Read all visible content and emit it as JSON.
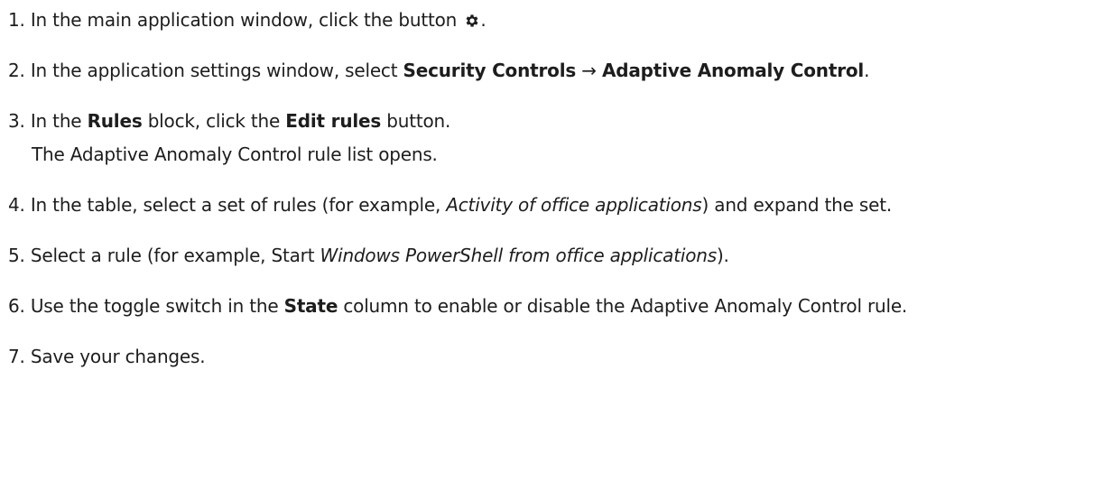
{
  "steps": [
    {
      "num": "1.",
      "a": " In the main application window, click the button ",
      "icon": "gear-icon",
      "b": "."
    },
    {
      "num": "2.",
      "a": " In the application settings window, select ",
      "bold1": "Security Controls",
      "arrow": " → ",
      "bold2": "Adaptive Anomaly Control",
      "b": "."
    },
    {
      "num": "3.",
      "a": " In the ",
      "bold1": "Rules",
      "mid": " block, click the ",
      "bold2": "Edit rules",
      "b": " button.",
      "sub": "The Adaptive Anomaly Control rule list opens."
    },
    {
      "num": "4.",
      "a": " In the table, select a set of rules (for example, ",
      "italic": "Activity of office applications",
      "b": ") and expand the set."
    },
    {
      "num": "5.",
      "a": " Select a rule (for example, Start ",
      "italic": "Windows PowerShell from office applications",
      "b": ")."
    },
    {
      "num": "6.",
      "a": " Use the toggle switch in the ",
      "bold1": "State",
      "b": " column to enable or disable the Adaptive Anomaly Control rule."
    },
    {
      "num": "7.",
      "a": " Save your changes."
    }
  ]
}
